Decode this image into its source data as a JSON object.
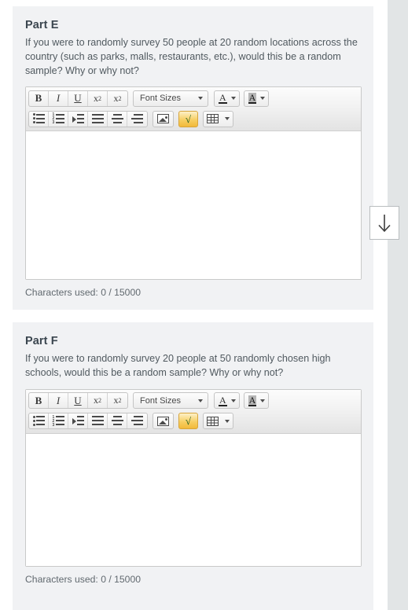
{
  "parts": [
    {
      "id": "e",
      "title": "Part E",
      "prompt": "If you were to randomly survey 50 people at 20 random locations across the country (such as parks, malls, restaurants, etc.), would this be a random sample? Why or why not?",
      "editor": {
        "content": "",
        "placeholder": "",
        "char_count": "Characters used: 0 / 15000"
      }
    },
    {
      "id": "f",
      "title": "Part F",
      "prompt": "If you were to randomly survey 20 people at 50 randomly chosen high schools, would this be a random sample? Why or why not?",
      "editor": {
        "content": "",
        "placeholder": "",
        "char_count": "Characters used: 0 / 15000"
      }
    }
  ],
  "toolbar": {
    "bold_label": "B",
    "italic_label": "I",
    "underline_label": "U",
    "superscript_label": "x",
    "superscript_sup": "2",
    "subscript_label": "x",
    "subscript_sub": "2",
    "font_size_label": "Font Sizes",
    "text_color_label": "A",
    "highlight_color_label": "A",
    "equation_label": "√"
  },
  "scroll_button": {
    "name": "scroll-down"
  },
  "colors": {
    "card_background": "#f1f2f4",
    "page_background": "#ffffff",
    "gutter": "#e2e5e6",
    "title_text": "#3b464f",
    "body_text": "#50595f",
    "editor_border": "#c9c9c9",
    "equation_highlight": "#f7cf63",
    "equation_glyph": "#1d5c1d"
  }
}
